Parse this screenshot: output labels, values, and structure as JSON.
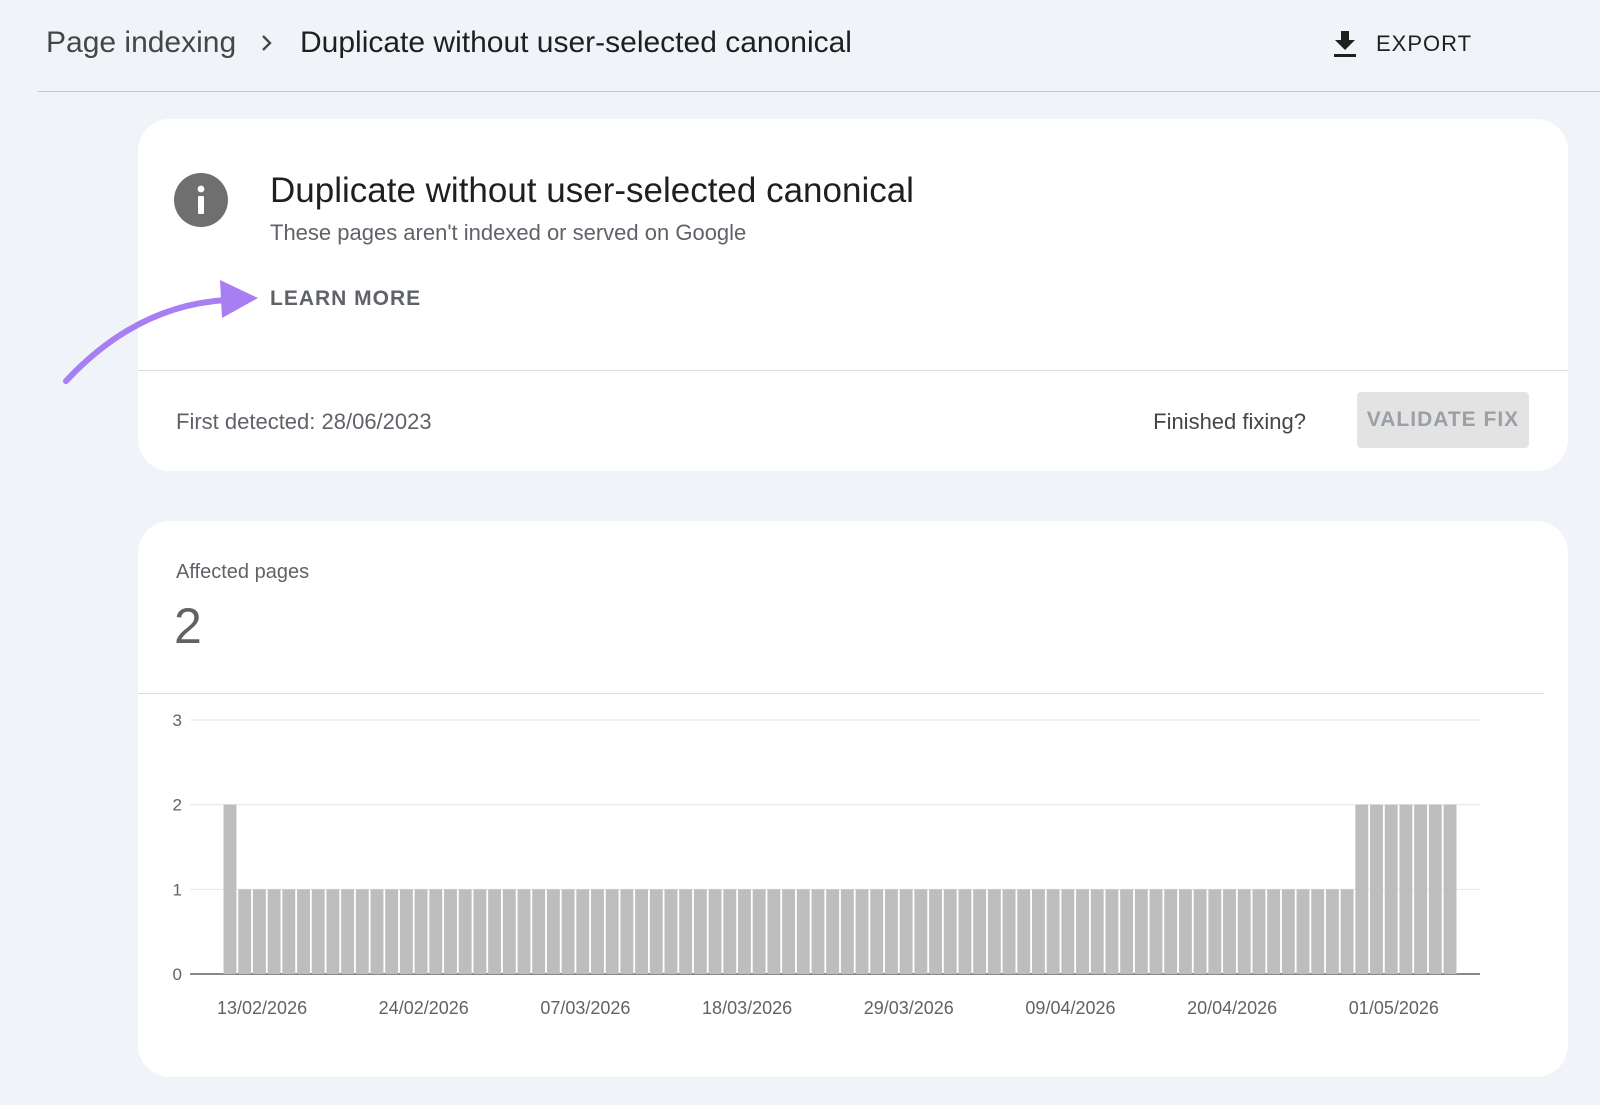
{
  "header": {
    "breadcrumb_root": "Page indexing",
    "breadcrumb_current": "Duplicate without user-selected canonical",
    "export_label": "EXPORT"
  },
  "issue": {
    "title": "Duplicate without user-selected canonical",
    "subtitle": "These pages aren't indexed or served on Google",
    "learn_more": "LEARN MORE",
    "first_detected": "First detected: 28/06/2023",
    "finished_fixing": "Finished fixing?",
    "validate_fix": "VALIDATE FIX"
  },
  "summary": {
    "affected_label": "Affected pages",
    "affected_count": "2"
  },
  "colors": {
    "background": "#f0f4f9",
    "card": "#ffffff",
    "bar": "#bdbdbd",
    "annotation_arrow": "#a87ff2"
  },
  "chart_data": {
    "type": "bar",
    "title": "",
    "xlabel": "",
    "ylabel": "",
    "ylim": [
      0,
      3
    ],
    "yticks": [
      0,
      1,
      2,
      3
    ],
    "grid": true,
    "x_tick_labels": [
      "13/02/2026",
      "24/02/2026",
      "07/03/2026",
      "18/03/2026",
      "29/03/2026",
      "09/04/2026",
      "20/04/2026",
      "01/05/2026"
    ],
    "x_start": "13/02/2026",
    "x_end": "08/05/2026",
    "values": [
      2,
      1,
      1,
      1,
      1,
      1,
      1,
      1,
      1,
      1,
      1,
      1,
      1,
      1,
      1,
      1,
      1,
      1,
      1,
      1,
      1,
      1,
      1,
      1,
      1,
      1,
      1,
      1,
      1,
      1,
      1,
      1,
      1,
      1,
      1,
      1,
      1,
      1,
      1,
      1,
      1,
      1,
      1,
      1,
      1,
      1,
      1,
      1,
      1,
      1,
      1,
      1,
      1,
      1,
      1,
      1,
      1,
      1,
      1,
      1,
      1,
      1,
      1,
      1,
      1,
      1,
      1,
      1,
      1,
      1,
      1,
      1,
      1,
      1,
      1,
      1,
      1,
      2,
      2,
      2,
      2,
      2,
      2,
      2
    ]
  }
}
